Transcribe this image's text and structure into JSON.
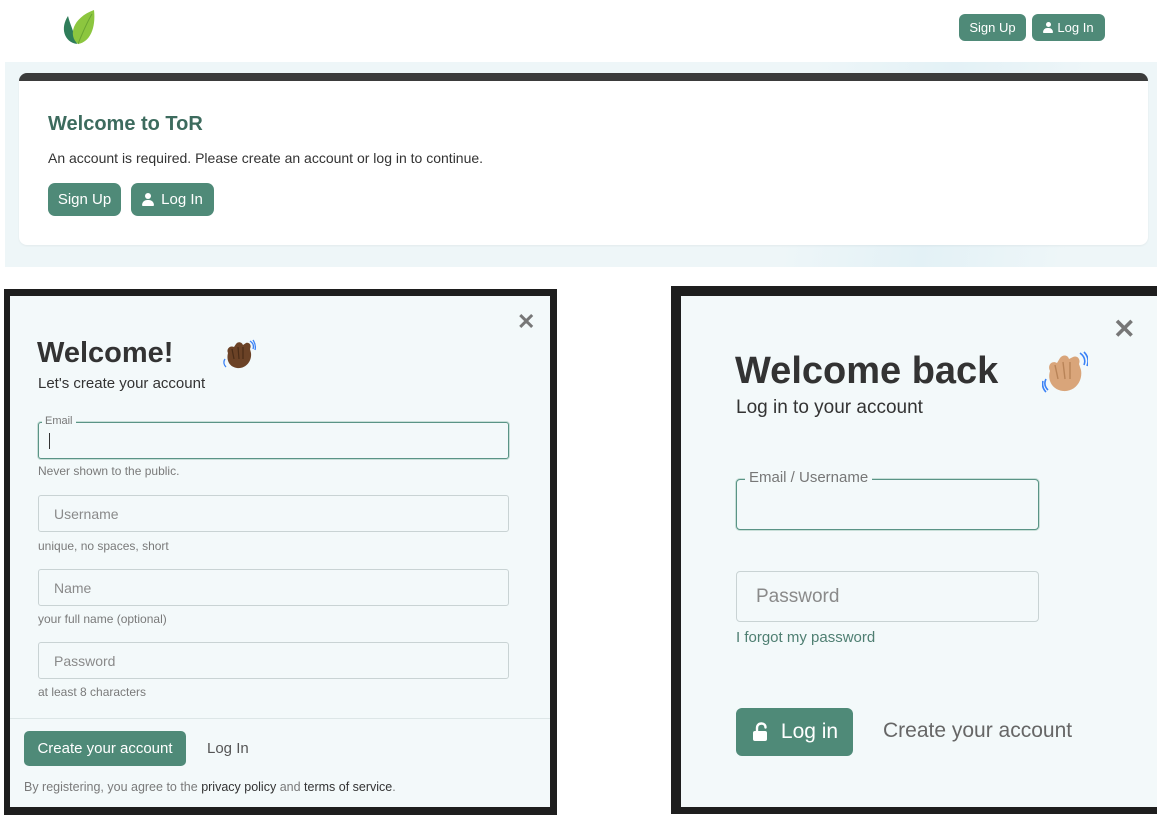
{
  "navbar": {
    "logo": "leaf-logo",
    "signup_label": "Sign Up",
    "login_label": "Log In"
  },
  "hero": {
    "title": "Welcome to ToR",
    "text": "An account is required. Please create an account or log in to continue.",
    "signup_label": "Sign Up",
    "login_label": "Log In"
  },
  "signup_modal": {
    "close_icon": "close-icon",
    "title": "Welcome!",
    "wave_emoji": "waving-hand-icon",
    "subtitle": "Let's create your account",
    "email_label": "Email",
    "email_value": "",
    "email_hint": "Never shown to the public.",
    "username_placeholder": "Username",
    "username_hint": "unique, no spaces, short",
    "name_placeholder": "Name",
    "name_hint": "your full name (optional)",
    "password_placeholder": "Password",
    "password_hint": "at least 8 characters",
    "create_button": "Create your account",
    "login_link": "Log In",
    "terms_prefix": "By registering, you agree to the ",
    "privacy_link": "privacy policy",
    "terms_and": " and ",
    "terms_link": "terms of service",
    "terms_suffix": "."
  },
  "login_modal": {
    "close_icon": "close-icon",
    "title": "Welcome back",
    "wave_emoji": "waving-hand-icon",
    "subtitle": "Log in to your account",
    "email_label": "Email / Username",
    "email_value": "",
    "password_placeholder": "Password",
    "forgot_link": "I forgot my password",
    "login_button": "Log in",
    "create_link": "Create your account"
  },
  "colors": {
    "accent": "#4f8a78",
    "title_green": "#3d6b5e",
    "modal_bg": "#f3f9fa"
  }
}
